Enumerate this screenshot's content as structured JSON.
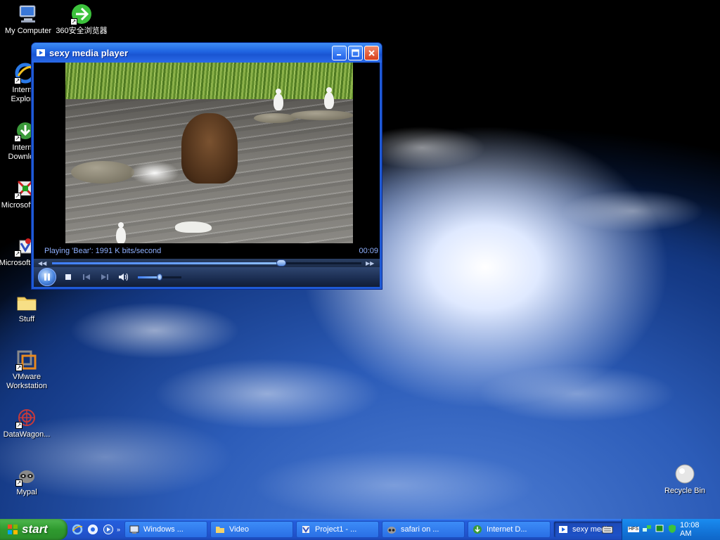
{
  "desktop": {
    "icons": [
      {
        "label": "My Computer"
      },
      {
        "label": "360安全浏览器"
      },
      {
        "label": "Internet Explorer"
      },
      {
        "label": "Internet Download"
      },
      {
        "label": "Microsoft C++"
      },
      {
        "label": "Microsoft Basic"
      },
      {
        "label": "Stuff"
      },
      {
        "label": "VMware Workstation"
      },
      {
        "label": "DataWagon..."
      },
      {
        "label": "Mypal"
      },
      {
        "label": "Recycle Bin"
      }
    ]
  },
  "player": {
    "title": "sexy media player",
    "status": "Playing 'Bear': 1991 K bits/second",
    "time": "00:09",
    "seek_percent": 74,
    "volume_percent": 50,
    "icons": {
      "app": "media-player-icon",
      "minimize": "minimize-icon",
      "maximize": "maximize-icon",
      "close": "close-icon",
      "pause": "pause-icon",
      "stop": "stop-icon",
      "previous": "previous-icon",
      "next": "next-icon",
      "volume": "volume-icon"
    }
  },
  "taskbar": {
    "start_label": "start",
    "tasks": [
      {
        "label": "Windows ...",
        "active": false
      },
      {
        "label": "Video",
        "active": false
      },
      {
        "label": "Project1 - ...",
        "active": false
      },
      {
        "label": "safari on ...",
        "active": false
      },
      {
        "label": "Internet D...",
        "active": false
      },
      {
        "label": "sexy medi...",
        "active": true
      }
    ],
    "tray": {
      "badge": "HFS",
      "clock": "10:08 AM"
    }
  },
  "colors": {
    "titlebar": "#1f63e0",
    "start": "#2f9a2f",
    "tray": "#1478dc",
    "status_text": "#8fb0ff"
  }
}
